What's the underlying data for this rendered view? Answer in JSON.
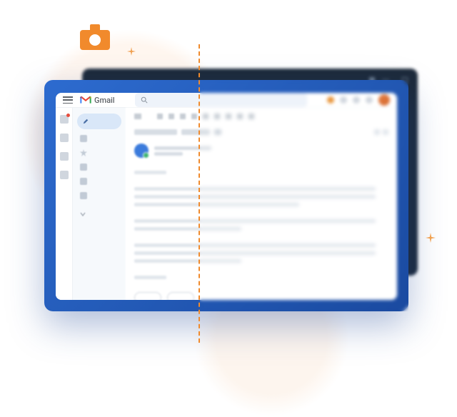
{
  "app": {
    "title": "Gmail"
  },
  "header": {
    "search_placeholder": ""
  },
  "sidebar": {
    "compose_label": ""
  },
  "icons": {
    "camera": "camera-icon",
    "sparkle": "sparkle-icon"
  }
}
